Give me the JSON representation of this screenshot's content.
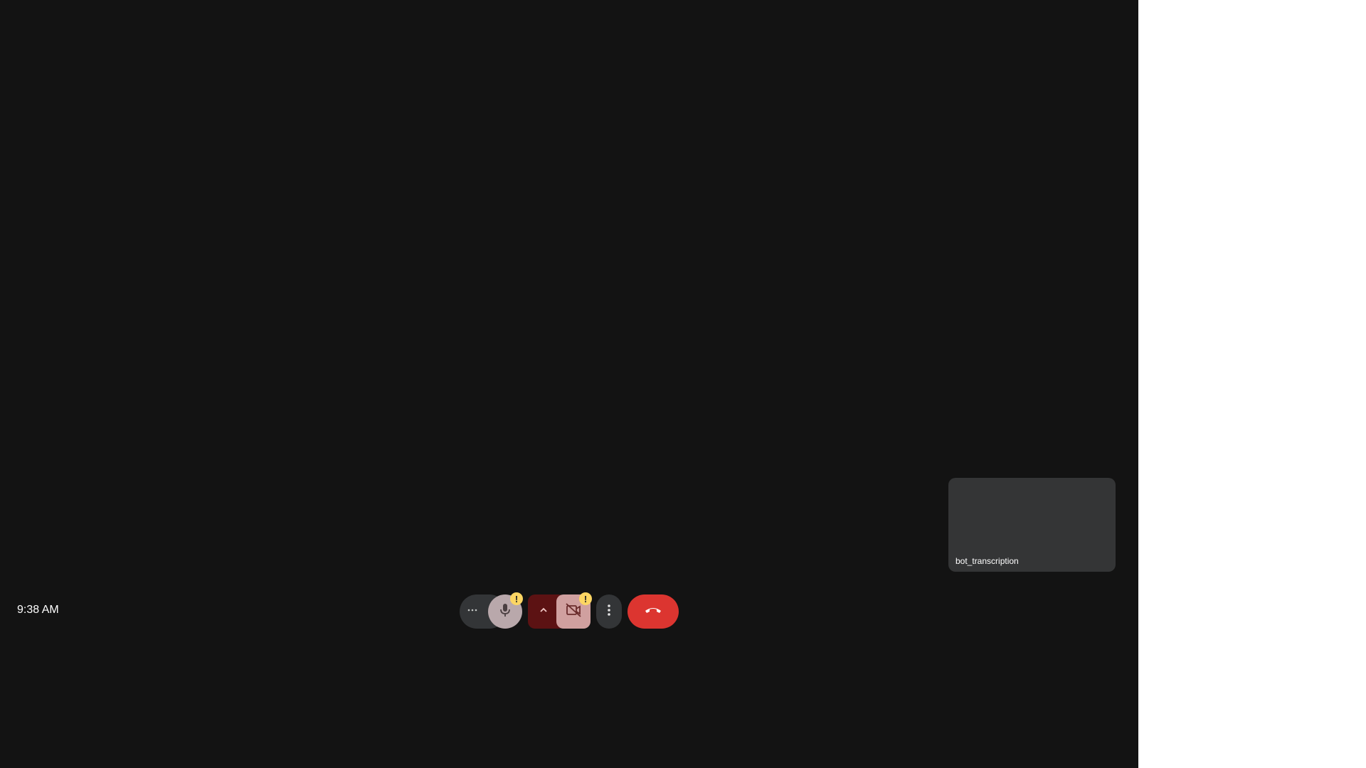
{
  "meeting": {
    "clock": "9:38 AM",
    "self_tile": {
      "name": "bot_transcription"
    }
  },
  "controls": {
    "audio_options_icon": "more-horizontal-icon",
    "mic_icon": "microphone-icon",
    "mic_warning": "!",
    "video_options_icon": "chevron-up-icon",
    "camera_icon": "video-off-icon",
    "camera_warning": "!",
    "more_options_icon": "more-vertical-icon",
    "leave_icon": "phone-hangup-icon"
  },
  "colors": {
    "background": "#131313",
    "tile": "#343536",
    "leave": "#dc3530",
    "warning": "#fdd663",
    "camera_off": "#d0a09f",
    "camera_group": "#5c1213",
    "mic": "#b9a8ab"
  }
}
